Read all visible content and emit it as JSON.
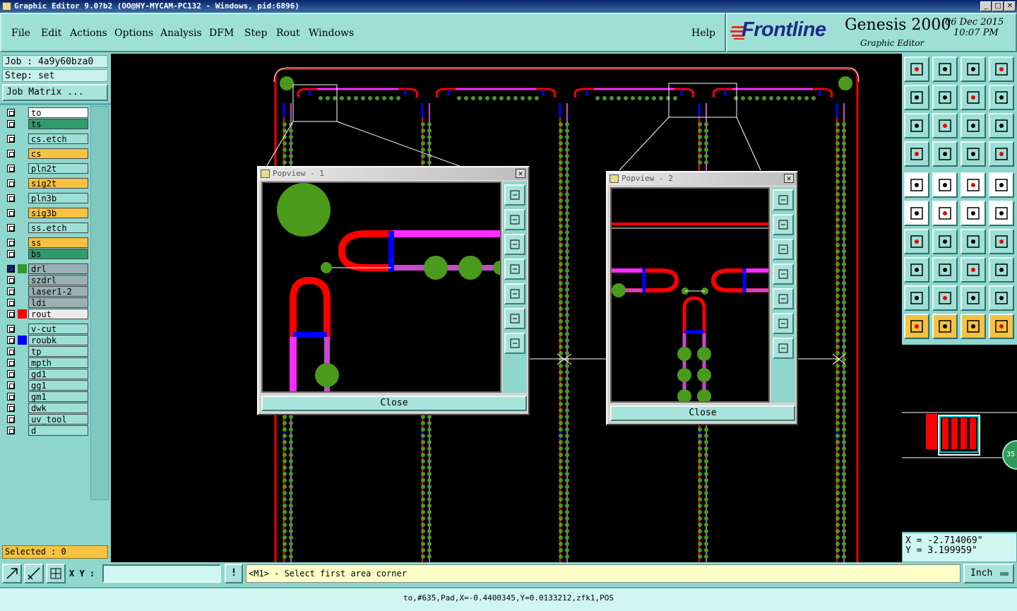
{
  "window": {
    "title": "Graphic Editor 9.0?b2 (OO@HY-MYCAM-PC132 - Windows, pid:6896)",
    "controls": [
      "_",
      "□",
      "✕"
    ]
  },
  "menu": [
    "File",
    "Edit",
    "Actions",
    "Options",
    "Analysis",
    "DFM",
    "Step",
    "Rout",
    "Windows"
  ],
  "help_label": "Help",
  "brand": {
    "logo": "Frontline",
    "product": "Genesis 2000",
    "subtitle": "Graphic Editor",
    "date": "06 Dec 2015",
    "time": "10:07 PM"
  },
  "job": {
    "job_label": "Job : 4a9y60bza0",
    "step_label": "Step: set",
    "matrix_button": "Job Matrix ..."
  },
  "layers": [
    {
      "name": "to",
      "bg": "#ffffff",
      "swatch": ""
    },
    {
      "name": "ts",
      "bg": "#2f9a6a",
      "swatch": ""
    },
    {
      "name": "cs.etch",
      "bg": "#9fe0d6",
      "swatch": ""
    },
    {
      "name": "cs",
      "bg": "#f5c242",
      "swatch": ""
    },
    {
      "name": "pln2t",
      "bg": "#9fe0d6",
      "swatch": ""
    },
    {
      "name": "sig2t",
      "bg": "#f5c242",
      "swatch": ""
    },
    {
      "name": "pln3b",
      "bg": "#9fe0d6",
      "swatch": ""
    },
    {
      "name": "sig3b",
      "bg": "#f5c242",
      "swatch": ""
    },
    {
      "name": "ss.etch",
      "bg": "#9fe0d6",
      "swatch": ""
    },
    {
      "name": "ss",
      "bg": "#f5c242",
      "swatch": ""
    },
    {
      "name": "bs",
      "bg": "#2f9a6a",
      "swatch": ""
    },
    {
      "name": "drl",
      "bg": "#9ab0b4",
      "swatch": "#2f9a2f"
    },
    {
      "name": "szdrl",
      "bg": "#9ab0b4",
      "swatch": ""
    },
    {
      "name": "laser1-2",
      "bg": "#9ab0b4",
      "swatch": ""
    },
    {
      "name": "ldi",
      "bg": "#9ab0b4",
      "swatch": ""
    },
    {
      "name": "rout",
      "bg": "#ececec",
      "swatch": "#ff0000"
    },
    {
      "name": "v-cut",
      "bg": "#9fe0d6",
      "swatch": ""
    },
    {
      "name": "roubk",
      "bg": "#9fe0d6",
      "swatch": "#0000ff"
    },
    {
      "name": "tp",
      "bg": "#9fe0d6",
      "swatch": ""
    },
    {
      "name": "mpth",
      "bg": "#9fe0d6",
      "swatch": ""
    },
    {
      "name": "gd1",
      "bg": "#9fe0d6",
      "swatch": ""
    },
    {
      "name": "gg1",
      "bg": "#9fe0d6",
      "swatch": ""
    },
    {
      "name": "gm1",
      "bg": "#9fe0d6",
      "swatch": ""
    },
    {
      "name": "dwk",
      "bg": "#9fe0d6",
      "swatch": ""
    },
    {
      "name": "uv_tool",
      "bg": "#9fe0d6",
      "swatch": ""
    },
    {
      "name": "d",
      "bg": "#9fe0d6",
      "swatch": ""
    }
  ],
  "selected_label": "Selected : 0",
  "popview1": {
    "title": "Popview - 1",
    "close_label": "Close"
  },
  "popview2": {
    "title": "Popview - 2",
    "close_label": "Close"
  },
  "coords": {
    "x": "X = -2.714069\"",
    "y": "Y = 3.199959\""
  },
  "minimap_badge": "35",
  "xy_label": "X Y :",
  "xy_value": "",
  "prompt": "<M1> - Select first area corner",
  "unit": "Inch",
  "status_line": "to,#635,Pad,X=-0.4400345,Y=0.0133212,zfk1,POS",
  "colors": {
    "teal": "#8fd6cd",
    "route": "#ff0000",
    "magenta": "#ff2bff",
    "blue": "#0000ff",
    "pad": "#4a9a1c"
  }
}
